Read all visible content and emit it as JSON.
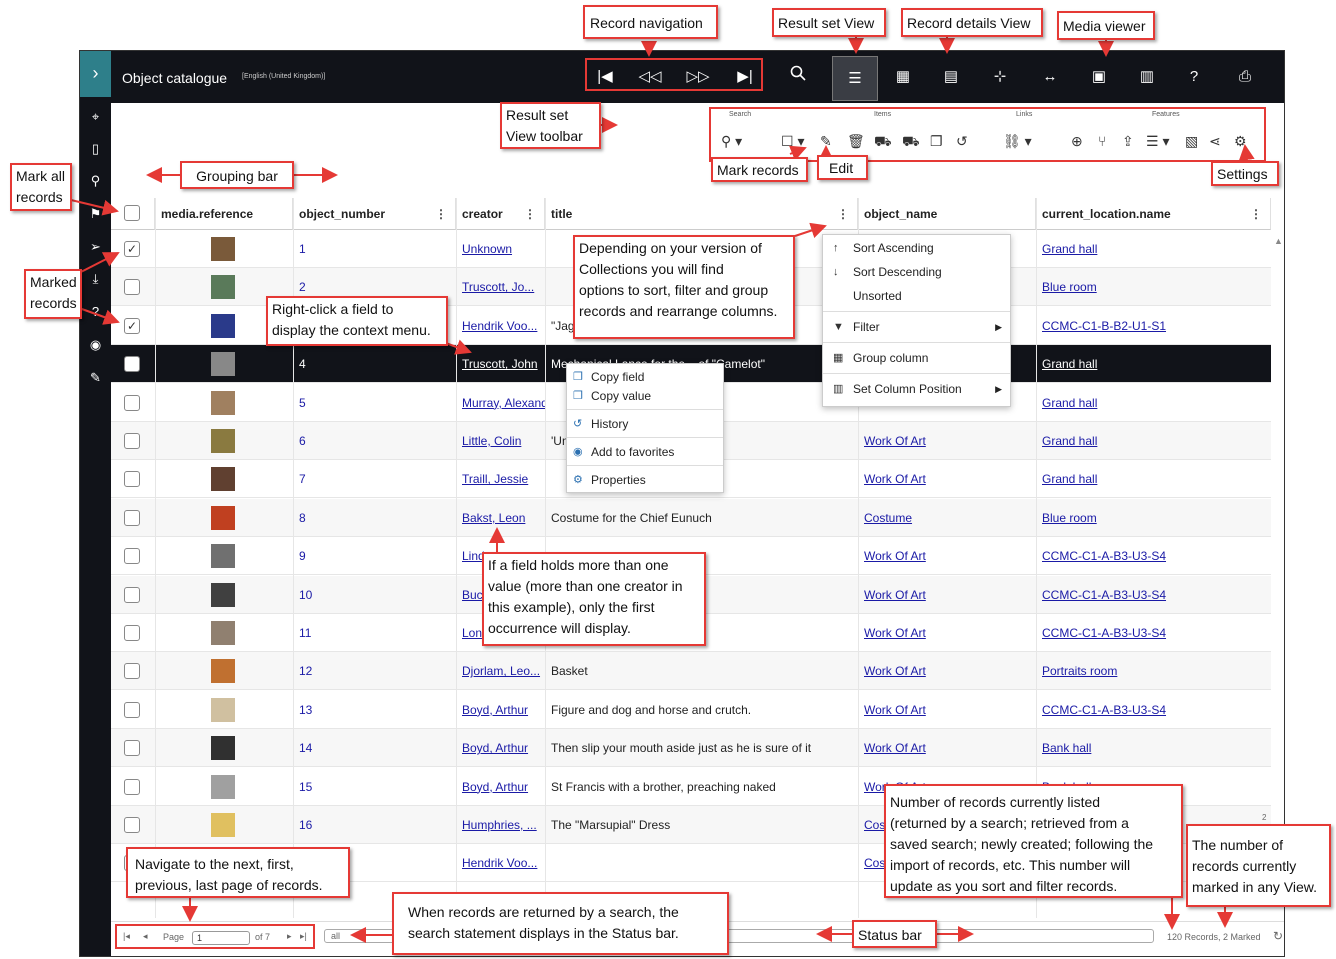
{
  "app": {
    "expand_icon": "chevron-right-icon",
    "title": "Object catalogue",
    "language": "[English (United Kingdom)]"
  },
  "toolbar_groups": {
    "search": "Search",
    "items": "Items",
    "links": "Links",
    "features": "Features"
  },
  "columns": [
    "media.reference",
    "object_number",
    "creator",
    "title",
    "object_name",
    "current_location.name"
  ],
  "rows": [
    {
      "checked": "✓",
      "number": "1",
      "creator": "Unknown",
      "title": "",
      "object_name": "",
      "location": "Grand hall"
    },
    {
      "checked": "",
      "number": "2",
      "creator": "Truscott, Jo...",
      "title": "",
      "object_name": "",
      "location": "Blue room"
    },
    {
      "checked": "✓",
      "number": "3",
      "creator": "Hendrik Voo...",
      "title": "\"Jag",
      "object_name": "",
      "location": "CCMC-C1-B-B2-U1-S1"
    },
    {
      "checked": "",
      "number": "4",
      "creator": "Truscott, John",
      "title": "Mechanical Lance for the... of \"Camelot\"",
      "object_name": "",
      "location": "Grand hall"
    },
    {
      "checked": "",
      "number": "5",
      "creator": "Murray, Alexander",
      "title": "",
      "object_name": "",
      "location": "Grand hall"
    },
    {
      "checked": "",
      "number": "6",
      "creator": "Little, Colin",
      "title": "'Umbly Book'",
      "object_name": "Work Of Art",
      "location": "Grand hall"
    },
    {
      "checked": "",
      "number": "7",
      "creator": "Traill, Jessie",
      "title": "",
      "object_name": "Work Of Art",
      "location": "Grand hall"
    },
    {
      "checked": "",
      "number": "8",
      "creator": "Bakst, Leon",
      "title": "Costume for the Chief Eunuch",
      "object_name": "Costume",
      "location": "Blue room"
    },
    {
      "checked": "",
      "number": "9",
      "creator": "Lind",
      "title": "",
      "object_name": "Work Of Art",
      "location": "CCMC-C1-A-B3-U3-S4"
    },
    {
      "checked": "",
      "number": "10",
      "creator": "Buc",
      "title": "",
      "object_name": "Work Of Art",
      "location": "CCMC-C1-A-B3-U3-S4"
    },
    {
      "checked": "",
      "number": "11",
      "creator": "Lon",
      "title": "",
      "object_name": "Work Of Art",
      "location": "CCMC-C1-A-B3-U3-S4"
    },
    {
      "checked": "",
      "number": "12",
      "creator": "Djorlam, Leo...",
      "title": "Basket",
      "object_name": "Work Of Art",
      "location": "Portraits room"
    },
    {
      "checked": "",
      "number": "13",
      "creator": "Boyd, Arthur",
      "title": "Figure and dog and horse and crutch.",
      "object_name": "Work Of Art",
      "location": "CCMC-C1-A-B3-U3-S4"
    },
    {
      "checked": "",
      "number": "14",
      "creator": "Boyd, Arthur",
      "title": "Then slip your mouth aside just as he is sure of it",
      "object_name": "Work Of Art",
      "location": "Bank hall"
    },
    {
      "checked": "",
      "number": "15",
      "creator": "Boyd, Arthur",
      "title": "St Francis with a brother, preaching naked",
      "object_name": "Work Of Art",
      "location": "Bank hall"
    },
    {
      "checked": "",
      "number": "16",
      "creator": "Humphries, ...",
      "title": "The \"Marsupial\" Dress",
      "object_name": "Cos",
      "location": ""
    },
    {
      "checked": "",
      "number": "",
      "creator": "Hendrik Voo...",
      "title": "",
      "object_name": "Cos",
      "location": ""
    }
  ],
  "column_menu": {
    "sort_asc": "Sort Ascending",
    "sort_desc": "Sort Descending",
    "unsorted": "Unsorted",
    "filter": "Filter",
    "group": "Group column",
    "set_position": "Set Column Position"
  },
  "context_menu": {
    "copy_field": "Copy field",
    "copy_value": "Copy value",
    "history": "History",
    "favorites": "Add to favorites",
    "properties": "Properties"
  },
  "status": {
    "page_label": "Page",
    "page_value": "1",
    "of_pages": "of 7",
    "search_statement": "all",
    "records_info": "120 Records, 2 Marked",
    "scroll_number": "2"
  },
  "callouts": {
    "record_navigation": "Record navigation",
    "result_set_view": "Result set View",
    "record_details_view": "Record details View",
    "media_viewer": "Media viewer",
    "result_set_toolbar_1": "Result set",
    "result_set_toolbar_2": "View toolbar",
    "mark_all_1": "Mark all",
    "mark_all_2": "records",
    "grouping_bar": "Grouping bar",
    "mark_records": "Mark records",
    "edit": "Edit",
    "settings": "Settings",
    "marked_records_1": "Marked",
    "marked_records_2": "records",
    "right_click_1": "Right-click a field to",
    "right_click_2": "display the context menu.",
    "sort_info_1": "Depending on your version of",
    "sort_info_2": "Collections you will find",
    "sort_info_3": "options to sort, filter and group",
    "sort_info_4": "records and rearrange columns.",
    "multi_value_1": "If a field holds more than one",
    "multi_value_2": "value (more than one creator in",
    "multi_value_3": "this example), only the first",
    "multi_value_4": "occurrence will display.",
    "nav_pages_1": "Navigate to the next, first,",
    "nav_pages_2": "previous, last page of records.",
    "search_statement_1": "When records are returned by a search, the",
    "search_statement_2": "search statement displays in the Status bar.",
    "status_bar": "Status bar",
    "record_count_1": "Number of records currently listed",
    "record_count_2": "(returned by a search; retrieved from a",
    "record_count_3": "saved search; newly created; following the",
    "record_count_4": "import of records, etc. This number will",
    "record_count_5": "update as you sort and filter records.",
    "marked_count_1": "The number of",
    "marked_count_2": "records currently",
    "marked_count_3": "marked in any View."
  }
}
